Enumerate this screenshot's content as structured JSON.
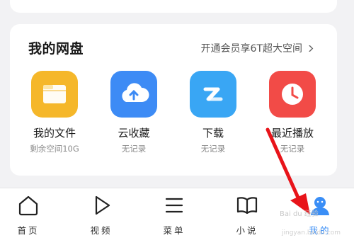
{
  "disk": {
    "title": "我的网盘",
    "promo": "开通会员享6T超大空间",
    "items": [
      {
        "label": "我的文件",
        "sub": "剩余空间10G",
        "icon": "folder-icon",
        "color": "#f5b72a"
      },
      {
        "label": "云收藏",
        "sub": "无记录",
        "icon": "cloud-upload-icon",
        "color": "#3d8bf5"
      },
      {
        "label": "下载",
        "sub": "无记录",
        "icon": "download-icon",
        "color": "#39a6f4"
      },
      {
        "label": "最近播放",
        "sub": "无记录",
        "icon": "clock-icon",
        "color": "#f24b47"
      }
    ]
  },
  "tabs": [
    {
      "label": "首页",
      "icon": "home-icon"
    },
    {
      "label": "视频",
      "icon": "play-icon"
    },
    {
      "label": "菜单",
      "icon": "menu-icon"
    },
    {
      "label": "小说",
      "icon": "book-icon"
    },
    {
      "label": "我的",
      "icon": "user-icon",
      "active": true
    }
  ],
  "watermark": "Bai du 经验",
  "watermark_url": "jingyan.baidu.com",
  "colors": {
    "accent": "#3a8ef6",
    "arrow": "#e8141a"
  }
}
